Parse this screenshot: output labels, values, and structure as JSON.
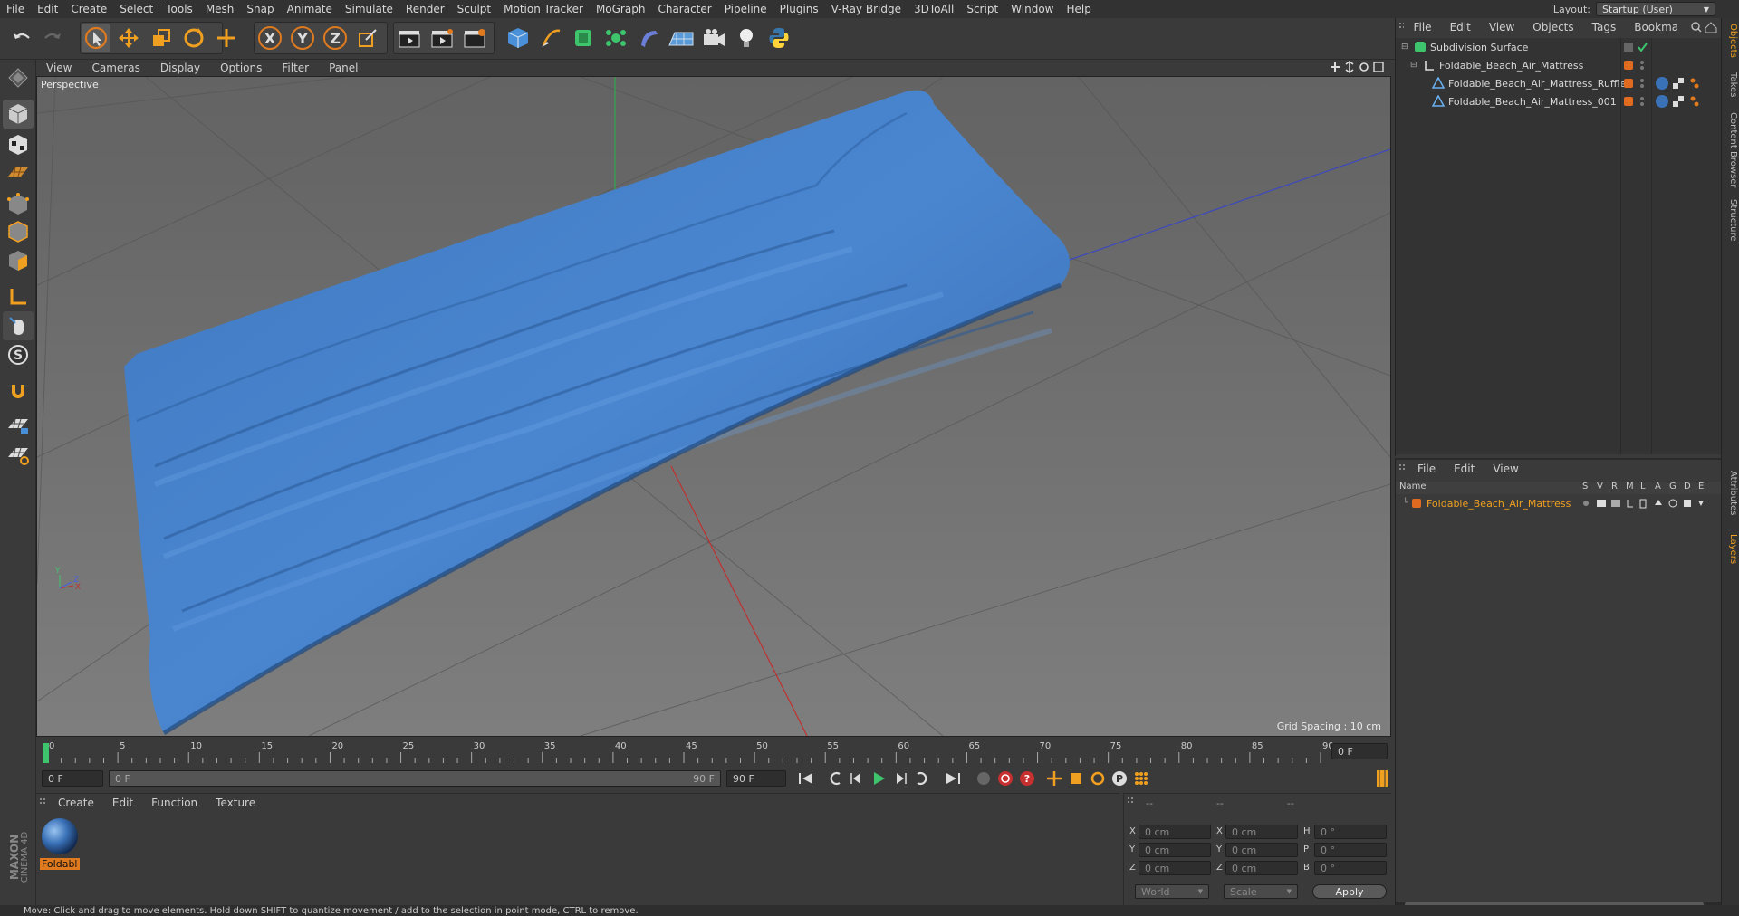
{
  "menubar": {
    "items": [
      "File",
      "Edit",
      "Create",
      "Select",
      "Tools",
      "Mesh",
      "Snap",
      "Animate",
      "Simulate",
      "Render",
      "Sculpt",
      "Motion Tracker",
      "MoGraph",
      "Character",
      "Pipeline",
      "Plugins",
      "V-Ray Bridge",
      "3DToAll",
      "Script",
      "Window",
      "Help"
    ],
    "layout_label": "Layout:",
    "layout_value": "Startup (User)"
  },
  "toolbar": {
    "axis_x": "X",
    "axis_y": "Y",
    "axis_z": "Z"
  },
  "viewport": {
    "menu": [
      "View",
      "Cameras",
      "Display",
      "Options",
      "Filter",
      "Panel"
    ],
    "camera_label": "Perspective",
    "grid_spacing": "Grid Spacing : 10 cm",
    "axis_labels": {
      "x": "X",
      "y": "Y",
      "z": "Z"
    }
  },
  "timeline": {
    "ticks": [
      "0",
      "5",
      "10",
      "15",
      "20",
      "25",
      "30",
      "35",
      "40",
      "45",
      "50",
      "55",
      "60",
      "65",
      "70",
      "75",
      "80",
      "85",
      "90"
    ],
    "current_frame_field": "0 F",
    "start_field": "0 F",
    "range_start": "0 F",
    "range_end": "90 F",
    "end_field": "90 F"
  },
  "material_manager": {
    "menu": [
      "Create",
      "Edit",
      "Function",
      "Texture"
    ],
    "material_name": "Foldabl"
  },
  "coordinates": {
    "header": [
      "--",
      "--",
      "--"
    ],
    "rows": [
      {
        "a_label": "X",
        "a_val": "0 cm",
        "b_label": "X",
        "b_val": "0 cm",
        "c_label": "H",
        "c_val": "0 °"
      },
      {
        "a_label": "Y",
        "a_val": "0 cm",
        "b_label": "Y",
        "b_val": "0 cm",
        "c_label": "P",
        "c_val": "0 °"
      },
      {
        "a_label": "Z",
        "a_val": "0 cm",
        "b_label": "Z",
        "b_val": "0 cm",
        "c_label": "B",
        "c_val": "0 °"
      }
    ],
    "space": "World",
    "mode": "Scale",
    "apply": "Apply"
  },
  "object_manager": {
    "menu": [
      "File",
      "Edit",
      "View",
      "Objects",
      "Tags",
      "Bookma"
    ],
    "objects": [
      {
        "name": "Subdivision Surface"
      },
      {
        "name": "Foldable_Beach_Air_Mattress"
      },
      {
        "name": "Foldable_Beach_Air_Mattress_Ruffles"
      },
      {
        "name": "Foldable_Beach_Air_Mattress_001"
      }
    ]
  },
  "layer_manager": {
    "menu": [
      "File",
      "Edit",
      "View"
    ],
    "columns": {
      "name": "Name",
      "flags": [
        "S",
        "V",
        "R",
        "M",
        "L",
        "A",
        "G",
        "D",
        "E"
      ]
    },
    "layers": [
      {
        "name": "Foldable_Beach_Air_Mattress"
      }
    ]
  },
  "side_tabs": [
    "Objects",
    "Takes",
    "Content Browser",
    "Structure",
    "Attributes",
    "Layers"
  ],
  "brand": {
    "line1": "MAXON",
    "line2": "CINEMA 4D"
  },
  "status": "Move: Click and drag to move elements. Hold down SHIFT to quantize movement / add to the selection in point mode, CTRL to remove.",
  "colors": {
    "mattress": "#4a82c8",
    "accent": "#e07a1e",
    "play": "#3ec46d",
    "bg": "#3a3a3a"
  }
}
